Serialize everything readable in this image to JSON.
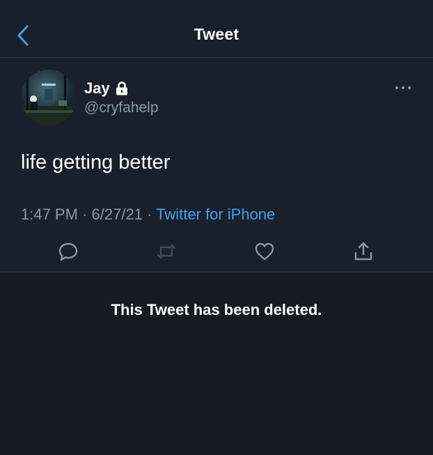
{
  "header": {
    "title": "Tweet",
    "back_icon": "chevron-left-icon"
  },
  "tweet": {
    "author": {
      "display_name": "Jay",
      "protected": true,
      "handle": "@cryfahelp"
    },
    "text": "life getting better",
    "time": "1:47 PM",
    "separator": "·",
    "date": "6/27/21",
    "source": "Twitter for iPhone",
    "actions": [
      "reply-icon",
      "retweet-icon",
      "like-icon",
      "share-icon"
    ]
  },
  "status_message": "This Tweet has been deleted.",
  "colors": {
    "background": "#151b23",
    "panel": "#17202b",
    "divider": "#2c3a48",
    "secondary_text": "#8899a6",
    "accent": "#4a9ee8",
    "retweet_disabled": "#3a4d5f"
  }
}
